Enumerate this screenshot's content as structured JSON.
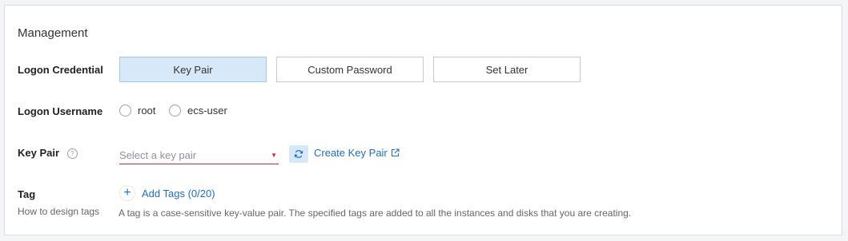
{
  "section": {
    "title": "Management"
  },
  "logon_credential": {
    "label": "Logon Credential",
    "options": [
      "Key Pair",
      "Custom Password",
      "Set Later"
    ],
    "selected": "Key Pair"
  },
  "logon_username": {
    "label": "Logon Username",
    "options": [
      "root",
      "ecs-user"
    ]
  },
  "key_pair": {
    "label": "Key Pair",
    "help_icon": "question-circle-icon",
    "placeholder": "Select a key pair",
    "refresh_icon": "refresh-icon",
    "create_link": "Create Key Pair",
    "external_icon": "external-link-icon"
  },
  "tag": {
    "label": "Tag",
    "sub_label": "How to design tags",
    "add_label": "Add Tags (0/20)",
    "hint": "A tag is a case-sensitive key-value pair. The specified tags are added to all the instances and disks that you are creating."
  },
  "colors": {
    "accent": "#1f6fbf",
    "selected_bg": "#d7e8f8",
    "error_line": "#d9262f"
  }
}
